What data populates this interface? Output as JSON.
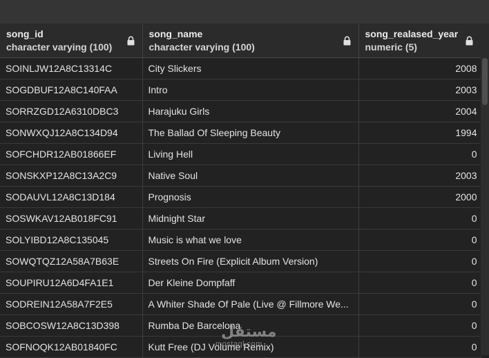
{
  "columns": [
    {
      "name": "song_id",
      "type": "character varying (100)"
    },
    {
      "name": "song_name",
      "type": "character varying (100)"
    },
    {
      "name": "song_realased_year",
      "type": "numeric (5)"
    }
  ],
  "rows": [
    [
      "SOINLJW12A8C13314C",
      "City Slickers",
      "2008"
    ],
    [
      "SOGDBUF12A8C140FAA",
      "Intro",
      "2003"
    ],
    [
      "SORRZGD12A6310DBC3",
      "Harajuku Girls",
      "2004"
    ],
    [
      "SONWXQJ12A8C134D94",
      "The Ballad Of Sleeping Beauty",
      "1994"
    ],
    [
      "SOFCHDR12AB01866EF",
      "Living Hell",
      "0"
    ],
    [
      "SONSKXP12A8C13A2C9",
      "Native Soul",
      "2003"
    ],
    [
      "SODAUVL12A8C13D184",
      "Prognosis",
      "2000"
    ],
    [
      "SOSWKAV12AB018FC91",
      "Midnight Star",
      "0"
    ],
    [
      "SOLYIBD12A8C135045",
      "Music is what we love",
      "0"
    ],
    [
      "SOWQTQZ12A58A7B63E",
      "Streets On Fire (Explicit Album Version)",
      "0"
    ],
    [
      "SOUPIRU12A6D4FA1E1",
      "Der Kleine Dompfaff",
      "0"
    ],
    [
      "SODREIN12A58A7F2E5",
      "A Whiter Shade Of Pale (Live @ Fillmore We...",
      "0"
    ],
    [
      "SOBCOSW12A8C13D398",
      "Rumba De Barcelona",
      "0"
    ],
    [
      "SOFNOQK12AB01840FC",
      "Kutt Free (DJ Volume Remix)",
      "0"
    ]
  ],
  "watermark": {
    "arabic": "مستقل",
    "latin": "mostaql.com"
  },
  "colors": {
    "background": "#222222",
    "header": "#2b2b2b",
    "toolbar": "#353535"
  },
  "icons": {
    "column_lock": "lock-icon"
  }
}
